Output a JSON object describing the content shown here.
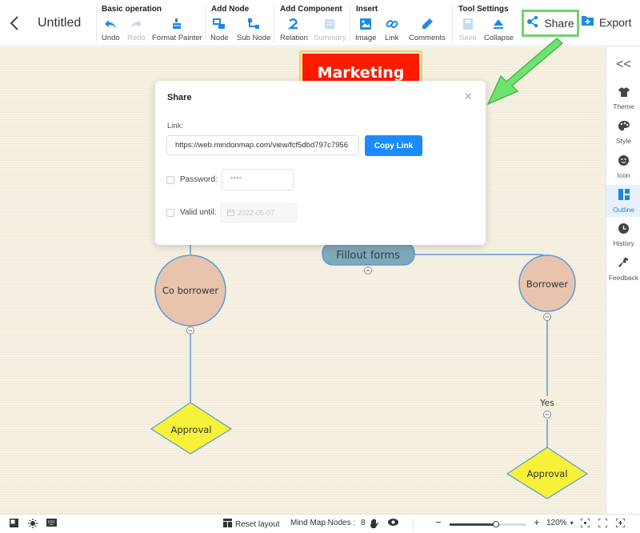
{
  "header": {
    "back_icon": "chevron-left-icon",
    "title": "Untitled"
  },
  "toolbar": {
    "groups": [
      {
        "title": "Basic operation",
        "tools": [
          {
            "label": "Undo",
            "icon": "undo-icon",
            "enabled": true
          },
          {
            "label": "Redo",
            "icon": "redo-icon",
            "enabled": false
          },
          {
            "label": "Format Painter",
            "icon": "format-painter-icon",
            "enabled": true
          }
        ]
      },
      {
        "title": "Add Node",
        "tools": [
          {
            "label": "Node",
            "icon": "add-node-icon",
            "enabled": true
          },
          {
            "label": "Sub Node",
            "icon": "add-subnode-icon",
            "enabled": true
          }
        ]
      },
      {
        "title": "Add Component",
        "tools": [
          {
            "label": "Relation",
            "icon": "relation-icon",
            "enabled": true
          },
          {
            "label": "Summary",
            "icon": "summary-icon",
            "enabled": false
          }
        ]
      },
      {
        "title": "Insert",
        "tools": [
          {
            "label": "Image",
            "icon": "image-icon",
            "enabled": true
          },
          {
            "label": "Link",
            "icon": "link-icon",
            "enabled": true
          },
          {
            "label": "Comments",
            "icon": "comments-icon",
            "enabled": true
          }
        ]
      },
      {
        "title": "Tool Settings",
        "tools": [
          {
            "label": "Save",
            "icon": "save-icon",
            "enabled": false
          },
          {
            "label": "Collapse",
            "icon": "collapse-icon",
            "enabled": true
          }
        ]
      }
    ],
    "share_label": "Share",
    "export_label": "Export",
    "accent_color": "#1e88e5",
    "highlight_color": "#6fd46f"
  },
  "mindmap": {
    "root": {
      "text": "Marketing",
      "fill": "#ff1a00"
    },
    "nodes": [
      {
        "id": "fillout",
        "text": "Fillout forms",
        "shape": "rounded-rect",
        "fill": "#7fa8b8"
      },
      {
        "id": "coborrower",
        "text": "Co borrower",
        "shape": "circle",
        "fill": "#e8c4ae"
      },
      {
        "id": "borrower",
        "text": "Borrower",
        "shape": "circle",
        "fill": "#e8c4ae"
      },
      {
        "id": "approval-left",
        "text": "Approval",
        "shape": "diamond",
        "fill": "#f7f13a"
      },
      {
        "id": "approval-right",
        "text": "Approval",
        "shape": "diamond",
        "fill": "#f7f13a"
      }
    ],
    "edge_labels": [
      {
        "text": "Yes"
      }
    ]
  },
  "share_dialog": {
    "title": "Share",
    "link_label": "Link:",
    "link_value": "https://web.mindonmap.com/view/fcf5dbd797c7956",
    "copy_button": "Copy Link",
    "password_label": "Password:",
    "password_value": "****",
    "password_checked": false,
    "valid_until_label": "Valid until:",
    "valid_until_value": "2022-05-07",
    "valid_until_checked": false,
    "close_icon": "close-icon"
  },
  "sidebar": {
    "collapse_label": "<<",
    "items": [
      {
        "label": "Theme",
        "icon": "shirt-icon",
        "active": false
      },
      {
        "label": "Style",
        "icon": "palette-icon",
        "active": false
      },
      {
        "label": "Icon",
        "icon": "smiley-icon",
        "active": false
      },
      {
        "label": "Outline",
        "icon": "outline-icon",
        "active": true
      },
      {
        "label": "History",
        "icon": "clock-icon",
        "active": false
      },
      {
        "label": "Feedback",
        "icon": "wrench-icon",
        "active": false
      }
    ]
  },
  "statusbar": {
    "reset_layout": "Reset layout",
    "node_count_label": "Mind Map Nodes :",
    "node_count": "8",
    "zoom_minus": "−",
    "zoom_plus": "+",
    "zoom_level": "120%",
    "zoom_slider_fraction": 0.6
  }
}
